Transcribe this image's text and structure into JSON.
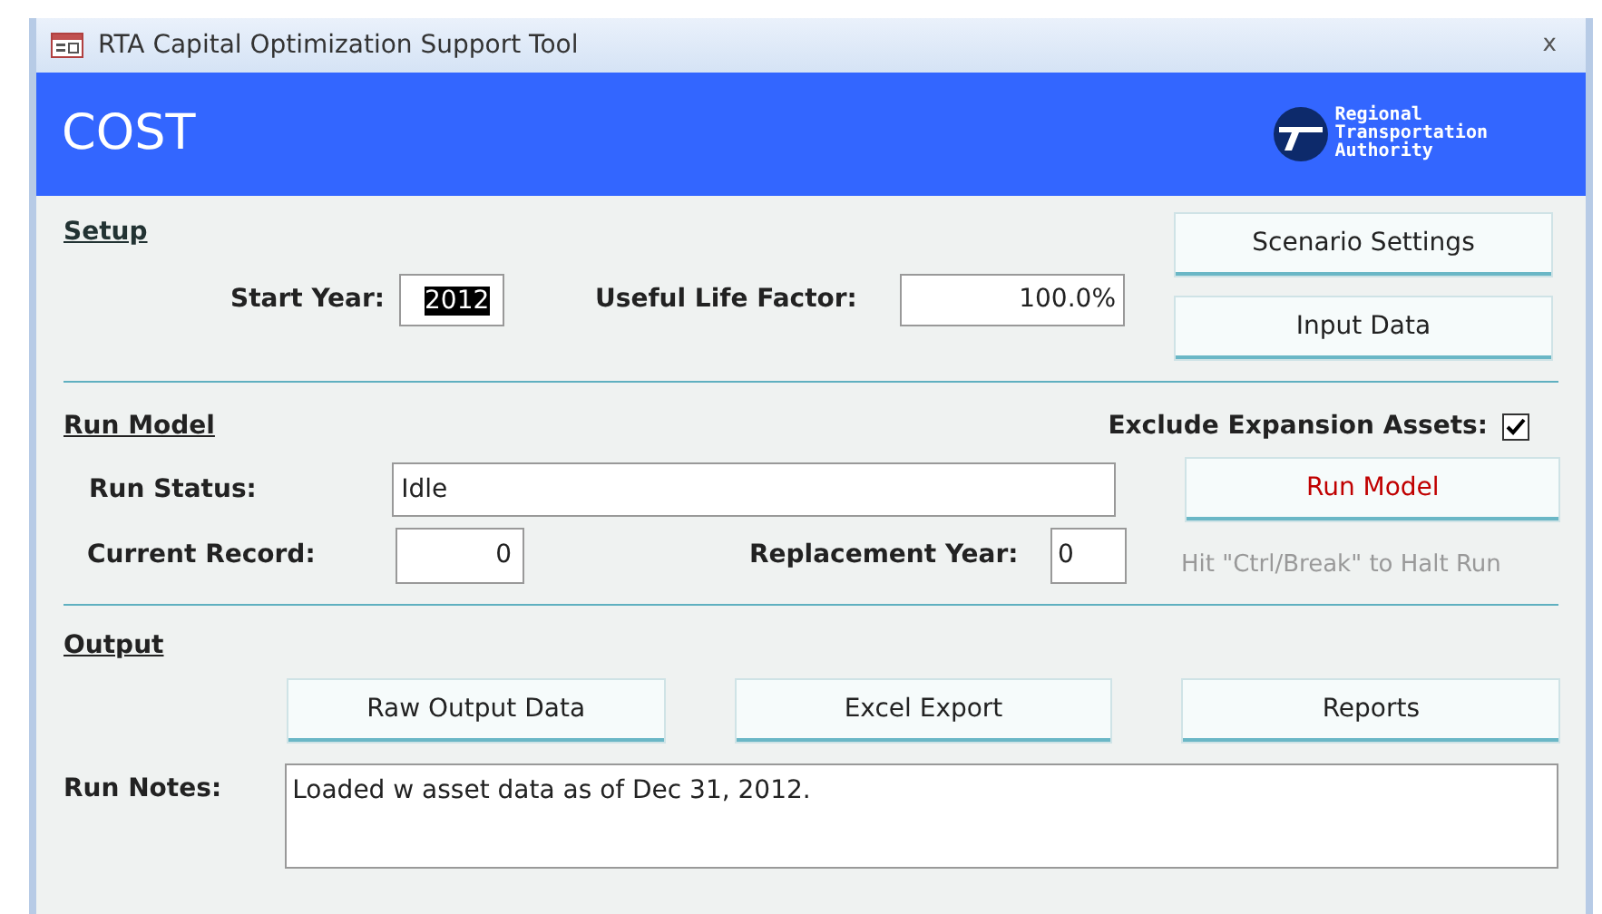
{
  "window": {
    "title": "RTA Capital Optimization Support Tool",
    "close": "x"
  },
  "header": {
    "title": "COST",
    "logo_lines": [
      "Regional",
      "Transportation",
      "Authority"
    ]
  },
  "setup": {
    "heading": "Setup",
    "start_year": {
      "label": "Start Year:",
      "value": "2012",
      "selected": true
    },
    "useful_life": {
      "label": "Useful Life Factor:",
      "value": "100.0%"
    },
    "buttons": [
      "Scenario Settings",
      "Input Data"
    ]
  },
  "run_model": {
    "heading": "Run Model",
    "exclude": {
      "label": "Exclude Expansion Assets:",
      "checked": true
    },
    "run_status": {
      "label": "Run Status:",
      "value": "Idle"
    },
    "run_button": "Run Model",
    "current_record": {
      "label": "Current Record:",
      "value": "0"
    },
    "replacement_year": {
      "label": "Replacement Year:",
      "value": "0"
    },
    "hint": "Hit \"Ctrl/Break\" to Halt Run"
  },
  "output": {
    "heading": "Output",
    "buttons": [
      "Raw Output Data",
      "Excel Export",
      "Reports"
    ],
    "notes": {
      "label": "Run Notes:",
      "value": "Loaded w asset data as of Dec 31, 2012."
    }
  }
}
